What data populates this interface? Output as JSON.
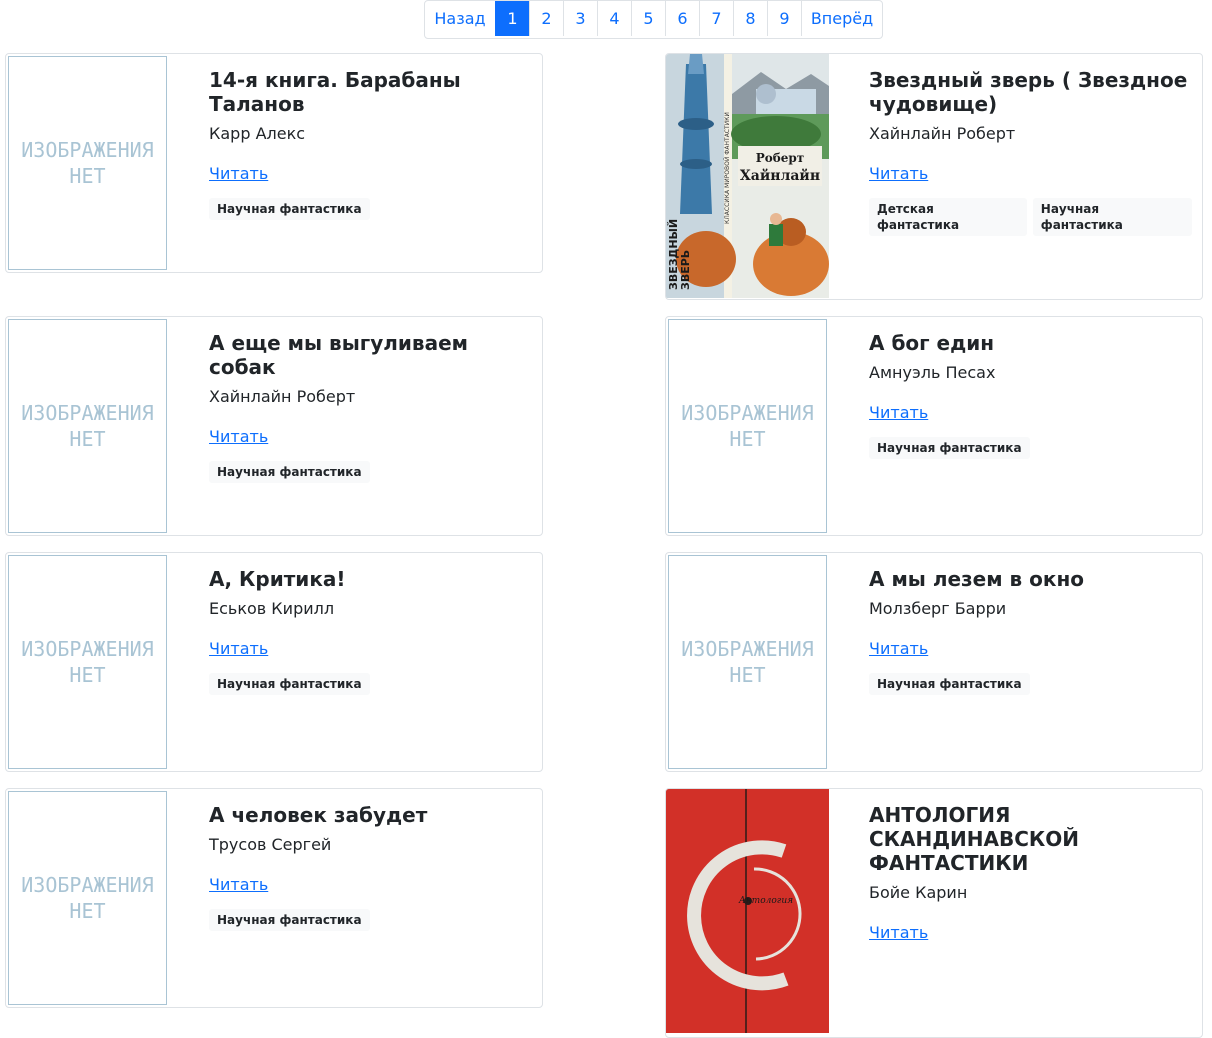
{
  "pagination": {
    "prev": "Назад",
    "pages": [
      "1",
      "2",
      "3",
      "4",
      "5",
      "6",
      "7",
      "8",
      "9"
    ],
    "next": "Вперёд",
    "active": "1"
  },
  "no_image_text": [
    "ИЗОБРАЖЕНИЯ",
    "НЕТ"
  ],
  "read_label": "Читать",
  "books": [
    {
      "title": "14-я книга. Барабаны Таланов",
      "author": "Карр Алекс",
      "tags": [
        "Научная фантастика"
      ]
    },
    {
      "title": "Звездный зверь ( Звездное чудовище)",
      "author": "Хайнлайн Роберт",
      "tags": [
        "Детская фантастика",
        "Научная фантастика"
      ]
    },
    {
      "title": "А еще мы выгуливаем собак",
      "author": "Хайнлайн Роберт",
      "tags": [
        "Научная фантастика"
      ]
    },
    {
      "title": "А бог един",
      "author": "Амнуэль Песах",
      "tags": [
        "Научная фантастика"
      ]
    },
    {
      "title": "А, Критика!",
      "author": "Еськов Кирилл",
      "tags": [
        "Научная фантастика"
      ]
    },
    {
      "title": "А мы лезем в окно",
      "author": "Молзберг Барри",
      "tags": [
        "Научная фантастика"
      ]
    },
    {
      "title": "А человек забудет",
      "author": "Трусов Сергей",
      "tags": [
        "Научная фантастика"
      ]
    },
    {
      "title": "АНТОЛОГИЯ СКАНДИНАВСКОЙ ФАНТАСТИКИ",
      "author": "Бойе Карин",
      "tags": []
    }
  ],
  "cover_texts": {
    "zverj_author": "Роберт Хайнлайн",
    "zverj_series": "КЛАССИКА МИРОВОЙ ФАНТАСТИКИ",
    "zverj_spine": "ЗВЕЗДНЫЙ ЗВЕРЬ",
    "antho_word": "Антология"
  }
}
